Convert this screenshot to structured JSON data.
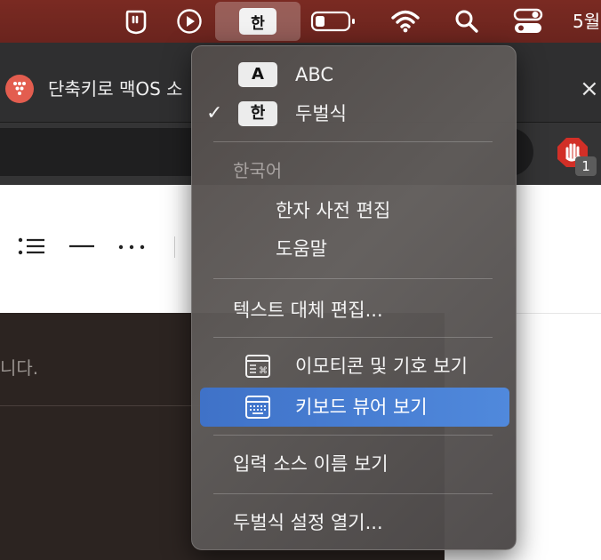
{
  "menubar": {
    "input_indicator": "한",
    "clock": "5월"
  },
  "browser": {
    "tab_title": "단축키로 맥OS 소",
    "tab_close": "×",
    "extension_badge": "1"
  },
  "content": {
    "text": "니다."
  },
  "input_menu": {
    "sources": [
      {
        "badge": "A",
        "label": "ABC",
        "checked": false
      },
      {
        "badge": "한",
        "label": "두벌식",
        "checked": true
      }
    ],
    "check_mark": "✓",
    "section_title": "한국어",
    "section_items": [
      "한자 사전 편집",
      "도움말"
    ],
    "text_replacement": "텍스트 대체 편집...",
    "emoji_viewer": "이모티콘 및 기호 보기",
    "keyboard_viewer": "키보드 뷰어 보기",
    "show_input_source_name": "입력 소스 이름 보기",
    "open_settings": "두벌식 설정 열기..."
  },
  "colors": {
    "menubar": "#742720",
    "highlight": "#4a80d4",
    "menu_background": "#5a5553"
  }
}
